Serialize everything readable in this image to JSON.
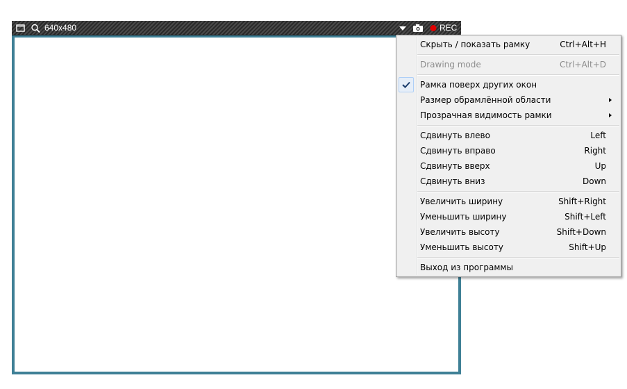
{
  "frame": {
    "size_label": "640x480",
    "rec_label": "REC",
    "icons": [
      "window-icon",
      "zoom-icon",
      "dropdown-arrow-icon",
      "camera-icon",
      "record-dot-icon"
    ],
    "colors": {
      "border": "#3f8096",
      "record": "#e00000"
    }
  },
  "menu": {
    "items": [
      {
        "label": "Скрыть / показать рамку",
        "shortcut": "Ctrl+Alt+H"
      },
      {
        "label": "Drawing mode",
        "shortcut": "Ctrl+Alt+D",
        "disabled": true
      },
      {
        "label": "Рамка поверх других окон",
        "checked": true
      },
      {
        "label": "Размер обрамлённой области",
        "submenu": true
      },
      {
        "label": "Прозрачная видимость рамки",
        "submenu": true
      },
      {
        "label": "Сдвинуть влево",
        "shortcut": "Left"
      },
      {
        "label": "Сдвинуть вправо",
        "shortcut": "Right"
      },
      {
        "label": "Сдвинуть вверх",
        "shortcut": "Up"
      },
      {
        "label": "Сдвинуть вниз",
        "shortcut": "Down"
      },
      {
        "label": "Увеличить ширину",
        "shortcut": "Shift+Right"
      },
      {
        "label": "Уменьшить ширину",
        "shortcut": "Shift+Left"
      },
      {
        "label": "Увеличить высоту",
        "shortcut": "Shift+Down"
      },
      {
        "label": "Уменьшить высоту",
        "shortcut": "Shift+Up"
      },
      {
        "label": "Выход из программы"
      }
    ]
  }
}
